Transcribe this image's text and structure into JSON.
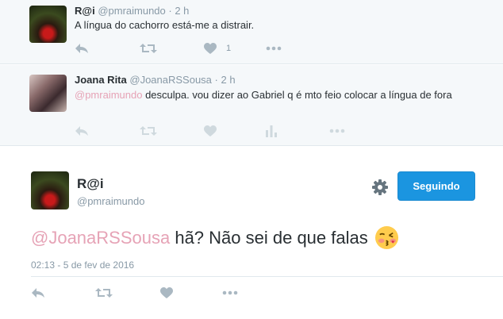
{
  "tweets": [
    {
      "name": "R@i",
      "screen_name": "@pmraimundo",
      "time": "· 2 h",
      "text": "A língua do cachorro está-me a distrair.",
      "like_count": "1"
    },
    {
      "name": "Joana Rita",
      "screen_name": "@JoanaRSSousa",
      "time": "· 2 h",
      "mention": "@pmraimundo",
      "text": " desculpa. vou dizer ao Gabriel q é mto feio colocar a língua de fora"
    }
  ],
  "main_tweet": {
    "name": "R@i",
    "screen_name": "@pmraimundo",
    "follow_label": "Seguindo",
    "mention": "@JoanaRSSousa",
    "text": " hã? Não sei de que falas",
    "emoji": "kissing-face-emoji",
    "timestamp": "02:13 - 5 de fev de 2016"
  },
  "colors": {
    "accent": "#1b95e0",
    "mention": "#e6a3b6",
    "muted": "#8899a6",
    "icon": "#aab8c2",
    "background_conversation": "#f5f8fa"
  },
  "icons": [
    "reply-icon",
    "retweet-icon",
    "like-icon",
    "analytics-icon",
    "more-icon",
    "gear-icon"
  ]
}
